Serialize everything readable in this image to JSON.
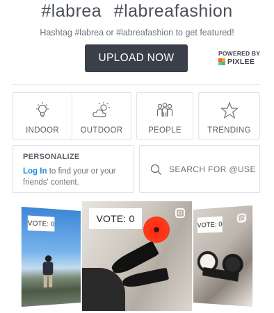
{
  "header": {
    "hashtag_1": "#labrea",
    "hashtag_2": "#labreafashion",
    "subtitle": "Hashtag #labrea or #labreafashion to get featured!"
  },
  "upload_button": "UPLOAD NOW",
  "powered_by": {
    "label": "POWERED BY",
    "brand": "PIXLEE",
    "logo_colors": [
      "#f15b5b",
      "#f9a21b",
      "#27b7e8",
      "#8dc63f"
    ]
  },
  "categories": [
    {
      "label": "INDOOR",
      "icon": "lightbulb-icon"
    },
    {
      "label": "OUTDOOR",
      "icon": "sun-cloud-icon"
    },
    {
      "label": "PEOPLE",
      "icon": "people-icon"
    },
    {
      "label": "TRENDING",
      "icon": "star-icon"
    }
  ],
  "personalize": {
    "title": "PERSONALIZE",
    "login_link": "Log In",
    "body_text": "to find your or your friends' content."
  },
  "search": {
    "placeholder": "SEARCH FOR @USE",
    "icon": "search-icon"
  },
  "gallery": [
    {
      "vote": "VOTE: 0",
      "description": "person at seaside cliff"
    },
    {
      "vote": "VOTE: 0",
      "description": "black heels with red flower"
    },
    {
      "vote": "VOTE: 0",
      "description": "wrist watches"
    }
  ],
  "colors": {
    "text": "#4a4f57",
    "button": "#3a3f4a",
    "link": "#1e8fd6",
    "border": "#dfe1e5"
  }
}
